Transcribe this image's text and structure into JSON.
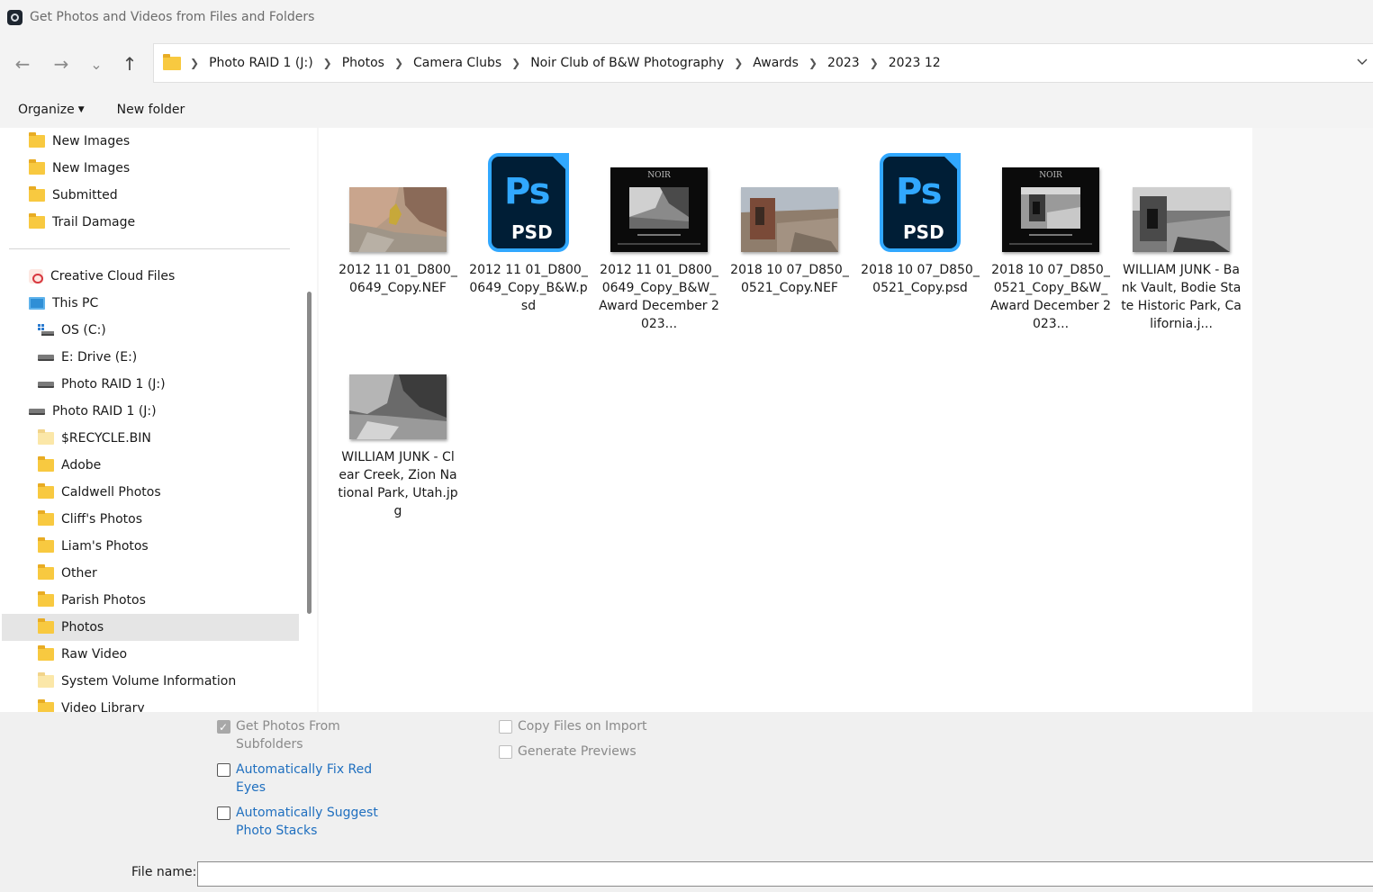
{
  "window": {
    "title": "Get Photos and Videos from Files and Folders"
  },
  "nav": {
    "back": "←",
    "forward": "→",
    "recent": "⌄",
    "up": "↑"
  },
  "breadcrumb": [
    "Photo RAID 1 (J:)",
    "Photos",
    "Camera Clubs",
    "Noir Club of B&W Photography",
    "Awards",
    "2023",
    "2023 12"
  ],
  "toolbar": {
    "organize": "Organize",
    "new_folder": "New folder"
  },
  "sidebar": {
    "top_items": [
      "New Images",
      "New Images",
      "Submitted",
      "Trail Damage"
    ],
    "creative_cloud": "Creative Cloud Files",
    "this_pc": "This PC",
    "pc_drives": [
      "OS (C:)",
      "E: Drive (E:)",
      "Photo RAID 1 (J:)"
    ],
    "raid": "Photo RAID 1 (J:)",
    "raid_folders": [
      "$RECYCLE.BIN",
      "Adobe",
      "Caldwell Photos",
      "Cliff's Photos",
      "Liam's Photos",
      "Other",
      "Parish Photos",
      "Photos",
      "Raw Video",
      "System Volume Information",
      "Video Library"
    ]
  },
  "files": [
    {
      "name": "2012 11 01_D800_0649_Copy.NEF",
      "kind": "photo-color-canyon"
    },
    {
      "name": "2012 11 01_D800_0649_Copy_B&W.psd",
      "kind": "psd-icon"
    },
    {
      "name": "2012 11 01_D800_0649_Copy_B&W_Award December 2023...",
      "kind": "award-bw"
    },
    {
      "name": "2018 10 07_D850_0521_Copy.NEF",
      "kind": "photo-color-ruin"
    },
    {
      "name": "2018 10 07_D850_0521_Copy.psd",
      "kind": "psd-icon"
    },
    {
      "name": "2018 10 07_D850_0521_Copy_B&W_Award December 2023...",
      "kind": "award-bw"
    },
    {
      "name": "WILLIAM JUNK - Bank Vault, Bodie State Historic Park, California.j...",
      "kind": "photo-bw-ruin"
    },
    {
      "name": "WILLIAM JUNK - Clear Creek, Zion National Park, Utah.jpg",
      "kind": "photo-bw-canyon"
    }
  ],
  "psd_icon": {
    "big": "Ps",
    "small": "PSD"
  },
  "award_text": "NOIR",
  "options": {
    "subfolders": "Get Photos From Subfolders",
    "fix_red_eyes": "Automatically Fix Red Eyes",
    "suggest_stacks": "Automatically Suggest Photo Stacks",
    "copy_files": "Copy Files on Import",
    "generate_previews": "Generate Previews"
  },
  "filename": {
    "label": "File name:",
    "value": ""
  }
}
